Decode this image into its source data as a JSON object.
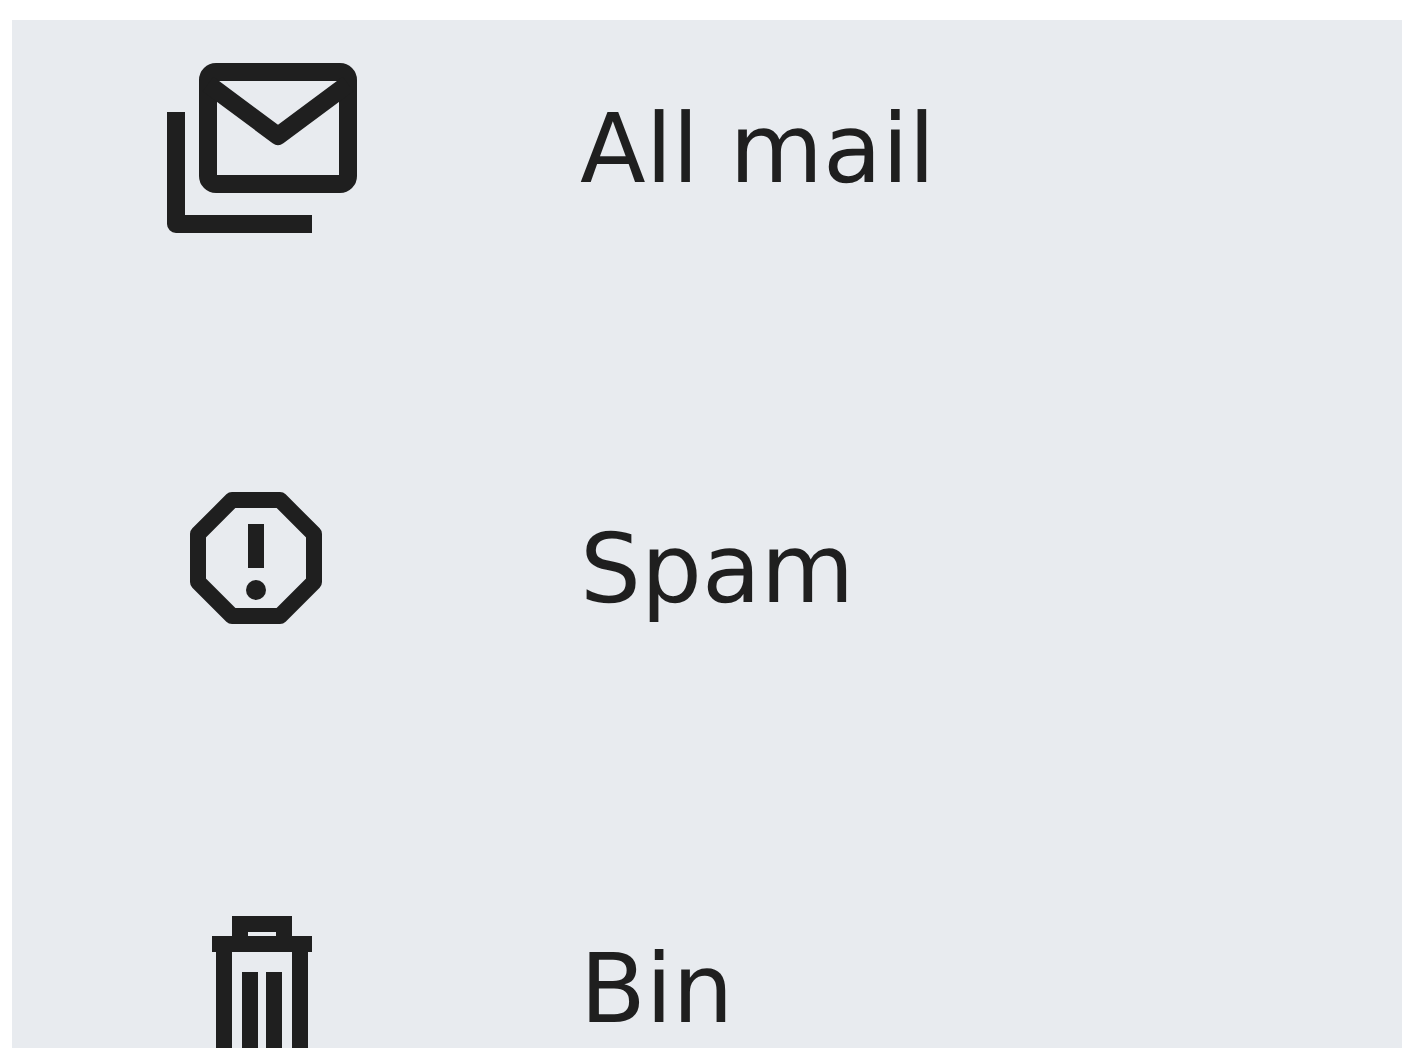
{
  "nav_items": [
    {
      "label": "All mail",
      "kind": "all-mail"
    },
    {
      "label": "Spam",
      "kind": "spam"
    },
    {
      "label": "Bin",
      "kind": "bin"
    }
  ]
}
